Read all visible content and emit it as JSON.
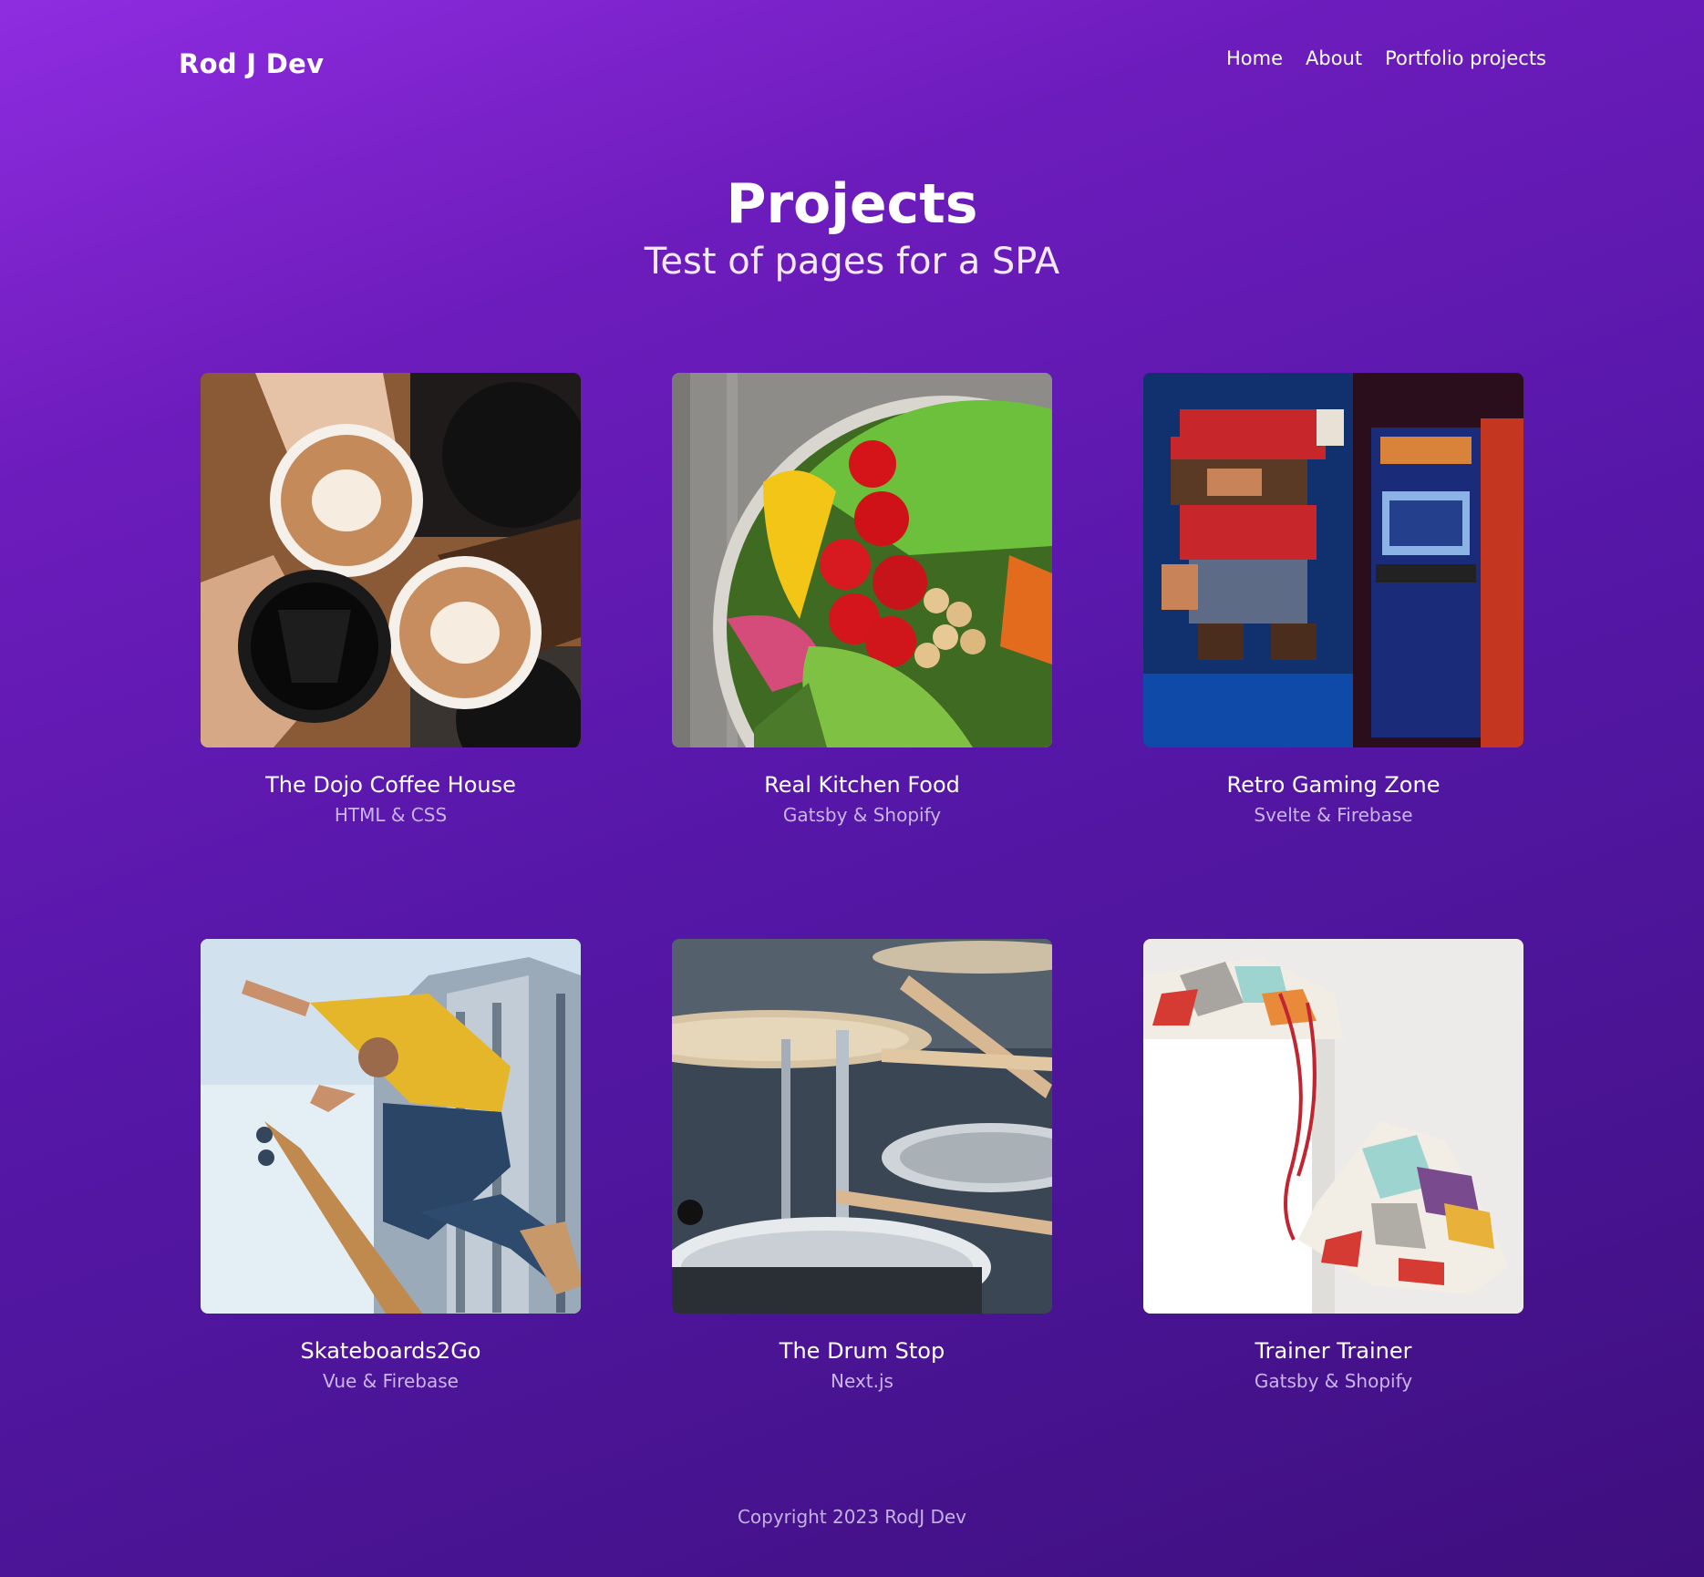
{
  "header": {
    "brand": "Rod J Dev",
    "nav": [
      {
        "label": "Home"
      },
      {
        "label": "About"
      },
      {
        "label": "Portfolio projects"
      }
    ]
  },
  "hero": {
    "title": "Projects",
    "subtitle": "Test of pages for a SPA"
  },
  "projects": [
    {
      "title": "The Dojo Coffee House",
      "tech": "HTML & CSS"
    },
    {
      "title": "Real Kitchen Food",
      "tech": "Gatsby & Shopify"
    },
    {
      "title": "Retro Gaming Zone",
      "tech": "Svelte & Firebase"
    },
    {
      "title": "Skateboards2Go",
      "tech": "Vue & Firebase"
    },
    {
      "title": "The Drum Stop",
      "tech": "Next.js"
    },
    {
      "title": "Trainer Trainer",
      "tech": "Gatsby & Shopify"
    }
  ],
  "footer": {
    "copyright": "Copyright 2023 RodJ Dev"
  },
  "colors": {
    "gradient_start": "#8f2ce0",
    "gradient_end": "#3e0f7e",
    "subtext": "#c9b5ea"
  }
}
